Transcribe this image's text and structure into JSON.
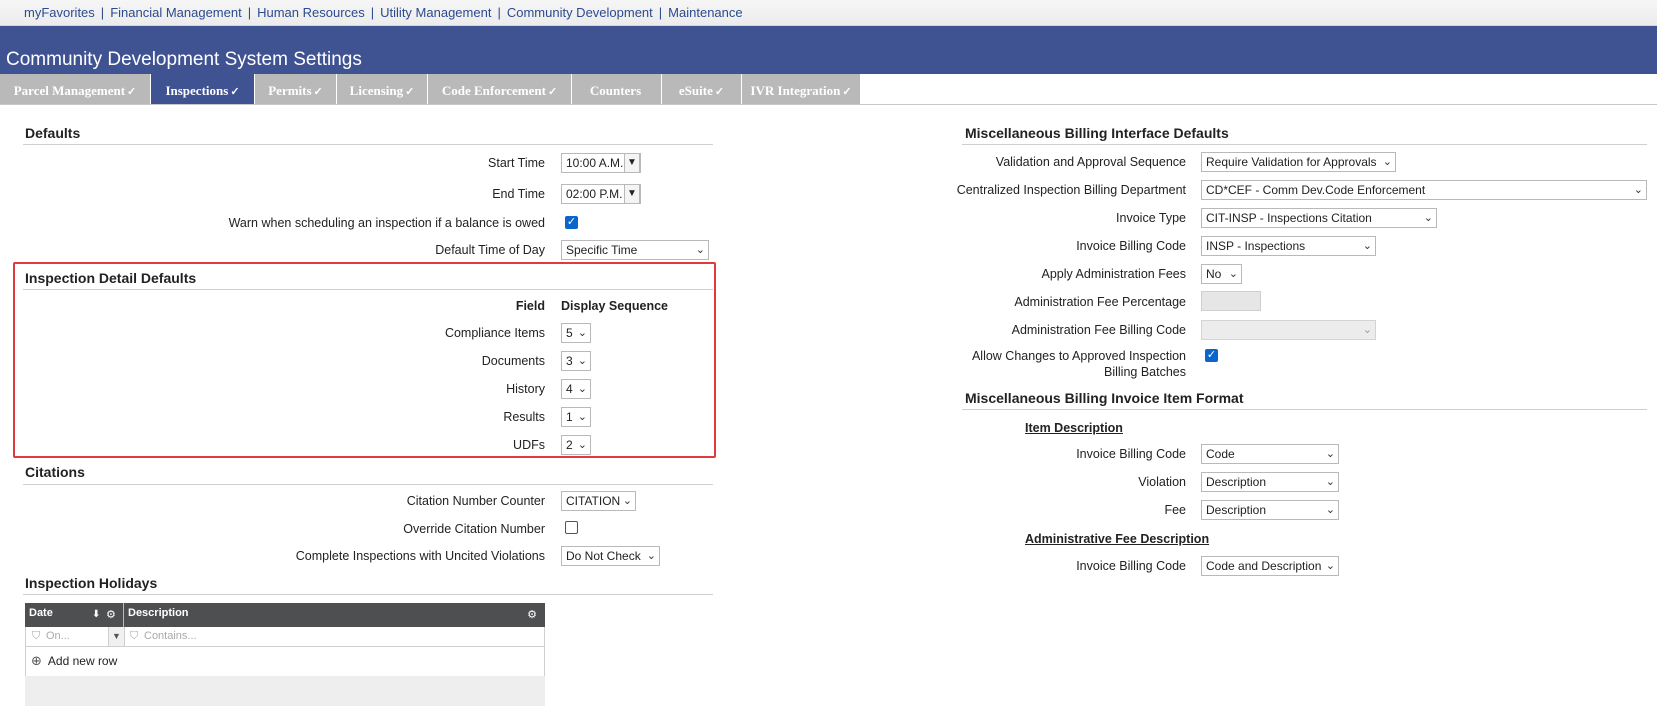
{
  "topnav": {
    "items": [
      "myFavorites",
      "Financial Management",
      "Human Resources",
      "Utility Management",
      "Community Development",
      "Maintenance"
    ],
    "separator": "|"
  },
  "header": {
    "title": "Community Development System Settings"
  },
  "tabs": [
    {
      "label": "Parcel Management",
      "check": "✓"
    },
    {
      "label": "Inspections",
      "check": "✓"
    },
    {
      "label": "Permits",
      "check": "✓"
    },
    {
      "label": "Licensing",
      "check": "✓"
    },
    {
      "label": "Code Enforcement",
      "check": "✓"
    },
    {
      "label": "Counters",
      "check": ""
    },
    {
      "label": "eSuite",
      "check": "✓"
    },
    {
      "label": "IVR Integration",
      "check": "✓"
    }
  ],
  "defaults": {
    "heading": "Defaults",
    "start_time_label": "Start Time",
    "start_time": "10:00 A.M.",
    "end_time_label": "End Time",
    "end_time": "02:00 P.M.",
    "warn_label": "Warn when scheduling an inspection if a balance is owed",
    "warn_checked": true,
    "tod_label": "Default Time of Day",
    "tod_value": "Specific Time"
  },
  "inspection_detail": {
    "heading": "Inspection Detail Defaults",
    "col_field": "Field",
    "col_seq": "Display Sequence",
    "rows": [
      {
        "field": "Compliance Items",
        "seq": "5"
      },
      {
        "field": "Documents",
        "seq": "3"
      },
      {
        "field": "History",
        "seq": "4"
      },
      {
        "field": "Results",
        "seq": "1"
      },
      {
        "field": "UDFs",
        "seq": "2"
      }
    ]
  },
  "citations": {
    "heading": "Citations",
    "counter_label": "Citation Number Counter",
    "counter_value": "CITATION",
    "override_label": "Override Citation Number",
    "override_checked": false,
    "complete_label": "Complete Inspections with Uncited Violations",
    "complete_value": "Do Not Check"
  },
  "holidays": {
    "heading": "Inspection Holidays",
    "col_date": "Date",
    "col_desc": "Description",
    "filter_date_placeholder": "On...",
    "filter_desc_placeholder": "Contains...",
    "add_row": "Add new row"
  },
  "misc_billing": {
    "heading": "Miscellaneous Billing Interface Defaults",
    "validation_label": "Validation and Approval Sequence",
    "validation_value": "Require Validation for Approvals",
    "dept_label": "Centralized Inspection Billing Department",
    "dept_value": "CD*CEF - Comm Dev.Code Enforcement",
    "invoice_type_label": "Invoice Type",
    "invoice_type_value": "CIT-INSP - Inspections Citation",
    "billing_code_label": "Invoice Billing Code",
    "billing_code_value": "INSP - Inspections",
    "admin_fees_label": "Apply Administration Fees",
    "admin_fees_value": "No",
    "admin_pct_label": "Administration Fee Percentage",
    "admin_code_label": "Administration Fee Billing Code",
    "allow_label_1": "Allow Changes to Approved Inspection",
    "allow_label_2": "Billing Batches",
    "allow_checked": true
  },
  "item_format": {
    "heading": "Miscellaneous Billing Invoice Item Format",
    "item_desc": "Item Description",
    "ibc_label": "Invoice Billing Code",
    "ibc_value": "Code",
    "violation_label": "Violation",
    "violation_value": "Description",
    "fee_label": "Fee",
    "fee_value": "Description",
    "admin_desc": "Administrative Fee Description",
    "admin_ibc_label": "Invoice Billing Code",
    "admin_ibc_value": "Code and Description"
  },
  "colors": {
    "header": "#3f5291",
    "tab_inactive": "#b9b9b9",
    "highlight": "#e0393e",
    "link": "#2c4a8f"
  }
}
